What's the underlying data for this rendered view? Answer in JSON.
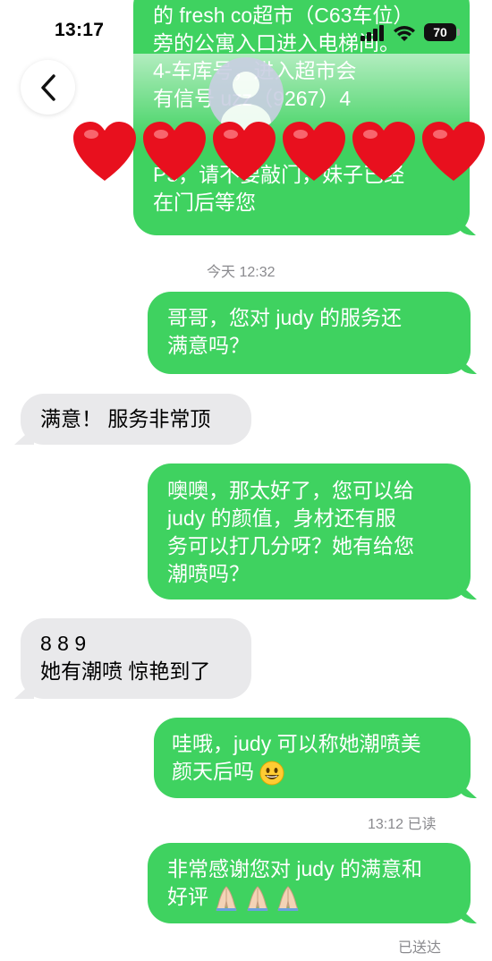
{
  "status_bar": {
    "time": "13:17",
    "battery": "70"
  },
  "nav": {
    "back_icon": "chevron-left-icon",
    "avatar_icon": "person-avatar-icon"
  },
  "overlay": {
    "heart_icon": "red-heart-icon",
    "heart_count": 6
  },
  "messages": {
    "m1": {
      "lines": [
        "的 fresh co超市（C63车位）",
        "旁的公寓入口进入电梯间。",
        "4-车库号，进入超市会",
        "有信号 uzz（9267）4",
        "P3，请不要敲门，妹子已经",
        "在门后等您"
      ]
    },
    "ts1": "今天 12:32",
    "m2": {
      "lines": [
        "哥哥，您对 judy 的服务还",
        "满意吗？"
      ]
    },
    "m3": {
      "lines": [
        "满意！ 服务非常顶"
      ]
    },
    "m4": {
      "lines": [
        "噢噢，那太好了，您可以给",
        "judy 的颜值，身材还有服",
        "务可以打几分呀？她有给您",
        "潮喷吗？"
      ]
    },
    "m5": {
      "lines": [
        "8 8 9",
        "她有潮喷 惊艳到了"
      ]
    },
    "m6": {
      "lines": [
        "哇哦，judy 可以称她潮喷美",
        "颜天后吗"
      ],
      "emoji_icon": "grinning-face-icon"
    },
    "read_receipt": "13:12 已读",
    "m7": {
      "lines": [
        "非常感谢您对 judy 的满意和",
        "好评"
      ],
      "emoji_icon": "folded-hands-icon"
    },
    "delivered": "已送达"
  },
  "colors": {
    "outgoing": "#3fd260",
    "incoming": "#e9e9eb",
    "meta": "#8a8a8e"
  }
}
